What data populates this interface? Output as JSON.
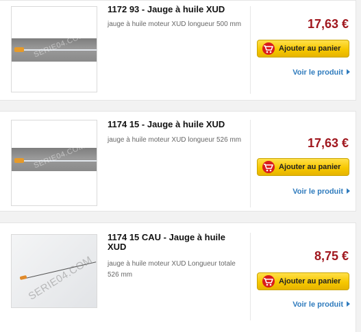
{
  "products": [
    {
      "reference": "1172 93",
      "name": "Jauge à huile XUD",
      "description": "jauge à huile moteur XUD longueur 500 mm",
      "price": "17,63 €",
      "cart_label": "Ajouter au panier",
      "view_label": "Voir le produit",
      "watermark": "SERIE04.COM"
    },
    {
      "reference": "1174 15",
      "name": "Jauge à huile XUD",
      "description": "jauge à huile moteur XUD longueur 526 mm",
      "price": "17,63 €",
      "cart_label": "Ajouter au panier",
      "view_label": "Voir le produit",
      "watermark": "SERIE04.COM"
    },
    {
      "reference": "1174 15 CAU",
      "name": "Jauge à huile XUD",
      "description": "jauge à huile moteur XUD Longueur totale 526 mm",
      "price": "8,75 €",
      "cart_label": "Ajouter au panier",
      "view_label": "Voir le produit",
      "watermark": "SERIE04.COM"
    }
  ],
  "colors": {
    "price": "#a0171e",
    "cart_button": "#f7c800",
    "link": "#2f7bbd"
  },
  "icons": [
    "shopping-cart-icon",
    "chevron-right-icon"
  ]
}
